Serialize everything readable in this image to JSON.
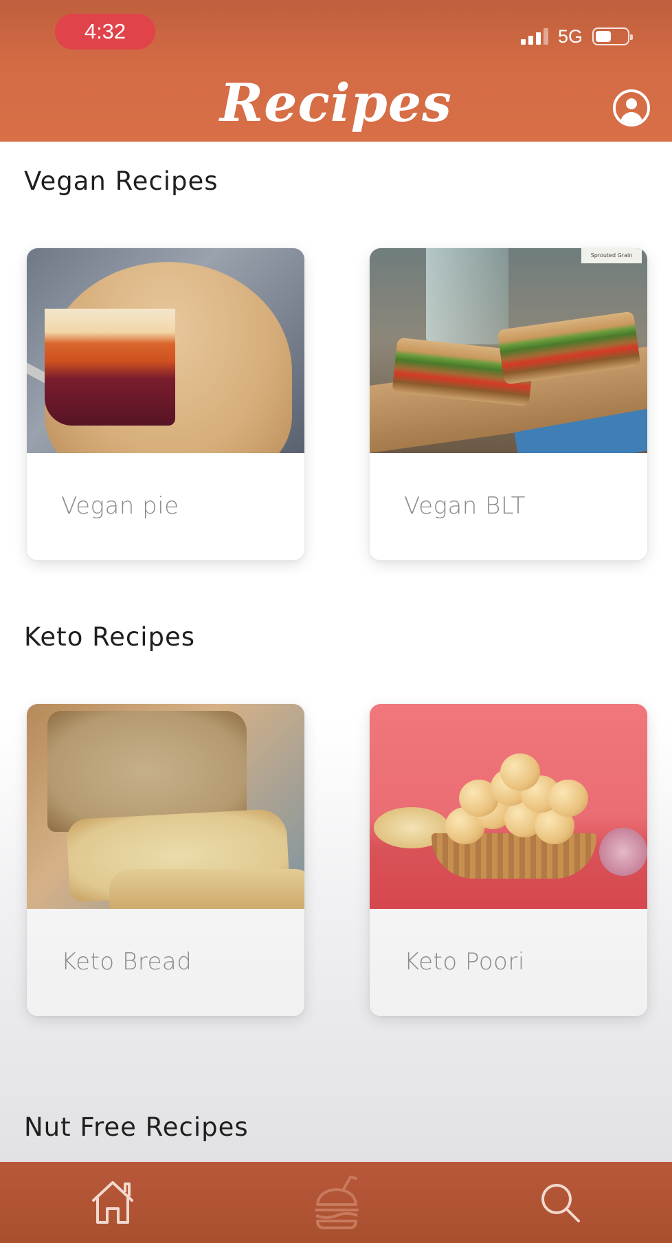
{
  "status_bar": {
    "time": "4:32",
    "network": "5G"
  },
  "header": {
    "title": "Recipes",
    "profile_icon": "profile-icon"
  },
  "sections": [
    {
      "title": "Vegan Recipes",
      "cards": [
        {
          "label": "Vegan pie",
          "image": "vegan-pie-photo"
        },
        {
          "label": "Vegan BLT",
          "image": "vegan-blt-photo",
          "image_tag": "Sprouted Grain"
        }
      ]
    },
    {
      "title": "Keto Recipes",
      "cards": [
        {
          "label": "Keto Bread",
          "image": "keto-bread-photo"
        },
        {
          "label": "Keto Poori",
          "image": "keto-poori-photo"
        }
      ]
    },
    {
      "title": "Nut Free Recipes",
      "cards": []
    }
  ],
  "bottom_nav": {
    "items": [
      {
        "icon": "home-icon"
      },
      {
        "icon": "burger-icon"
      },
      {
        "icon": "search-icon"
      }
    ]
  },
  "colors": {
    "header": "#d36b45",
    "time_pill": "#e0434a",
    "bottom_nav": "#b8583a"
  }
}
